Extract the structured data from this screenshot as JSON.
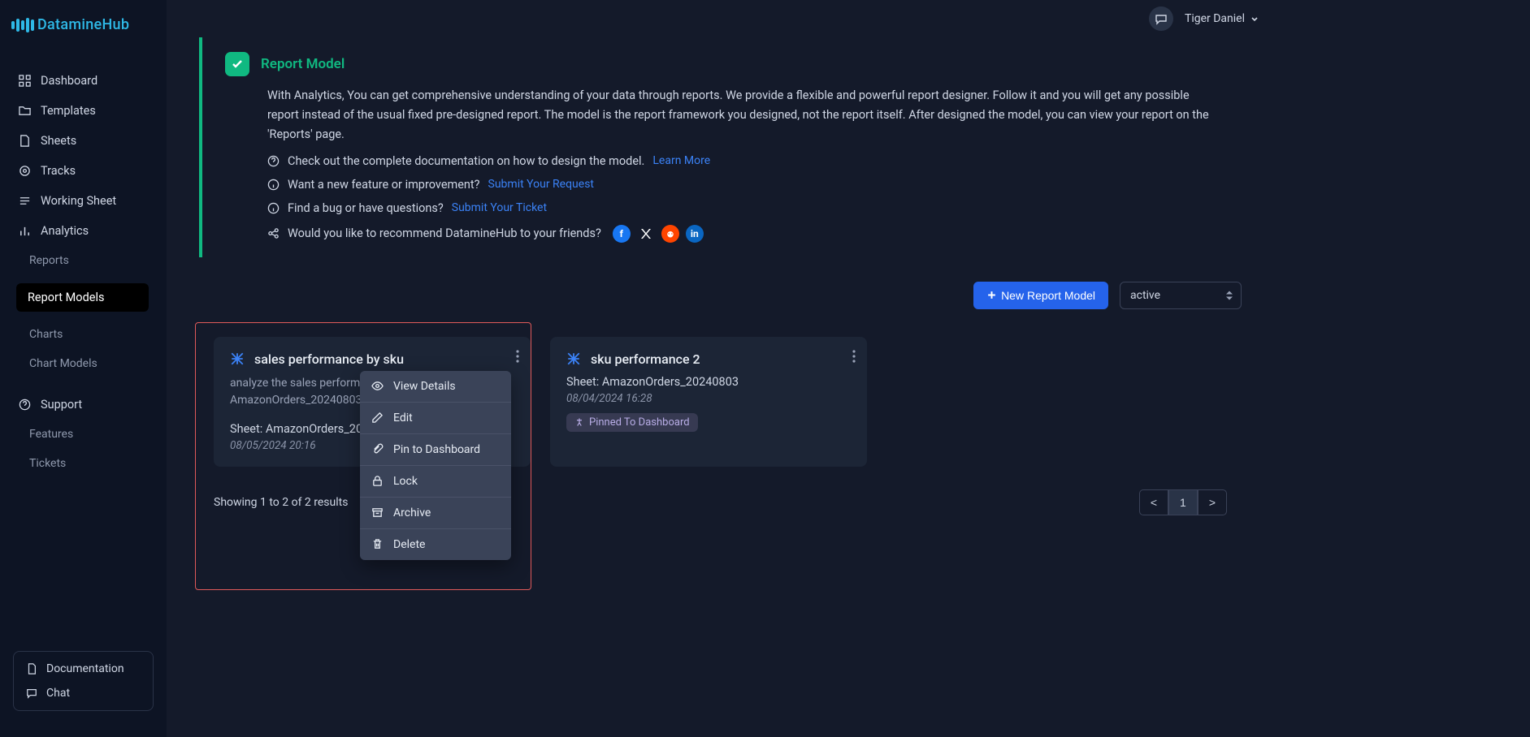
{
  "brand": "DatamineHub",
  "user": {
    "name": "Tiger Daniel"
  },
  "sidebar": {
    "items": [
      {
        "label": "Dashboard"
      },
      {
        "label": "Templates"
      },
      {
        "label": "Sheets"
      },
      {
        "label": "Tracks"
      },
      {
        "label": "Working Sheet"
      },
      {
        "label": "Analytics"
      }
    ],
    "subitems": [
      {
        "label": "Reports"
      },
      {
        "label": "Report Models"
      },
      {
        "label": "Charts"
      },
      {
        "label": "Chart Models"
      }
    ],
    "support": "Support",
    "sub2": [
      {
        "label": "Features"
      },
      {
        "label": "Tickets"
      }
    ],
    "bottom": [
      {
        "label": "Documentation"
      },
      {
        "label": "Chat"
      }
    ]
  },
  "info": {
    "title": "Report Model",
    "desc": "With Analytics, You can get comprehensive understanding of your data through reports. We provide a flexible and powerful report designer. Follow it and you will get any possible report instead of the usual fixed pre-designed report. The model is the report framework you designed, not the report itself. After designed the model, you can view your report on the 'Reports' page.",
    "line1_text": "Check out the complete documentation on how to design the model.",
    "line1_link": "Learn More",
    "line2_text": "Want a new feature or improvement?",
    "line2_link": "Submit Your Request",
    "line3_text": "Find a bug or have questions?",
    "line3_link": "Submit Your Ticket",
    "social_text": "Would you like to recommend DatamineHub to your friends?"
  },
  "toolbar": {
    "new_btn": "New Report Model",
    "filter": "active"
  },
  "cards": [
    {
      "title": "sales performance by sku",
      "desc": "analyze the sales performance by sku with sheet AmazonOrders_20240803",
      "sheet": "Sheet: AmazonOrders_20240803",
      "date": "08/05/2024 20:16"
    },
    {
      "title": "sku performance 2",
      "sheet": "Sheet: AmazonOrders_20240803",
      "date": "08/04/2024 16:28",
      "badge": "Pinned To Dashboard"
    }
  ],
  "context_menu": [
    "View Details",
    "Edit",
    "Pin to Dashboard",
    "Lock",
    "Archive",
    "Delete"
  ],
  "results": {
    "text": "Showing 1 to 2 of 2 results",
    "prev": "<",
    "page": "1",
    "next": ">"
  }
}
